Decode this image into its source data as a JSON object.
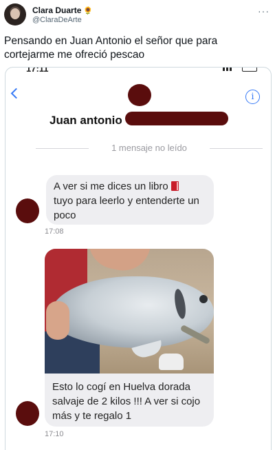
{
  "tweet": {
    "author_name": "Clara Duarte",
    "author_handle": "@ClaraDeArte",
    "text": "Pensando en Juan Antonio el señor que para cortejarme me ofreció pescao",
    "more_label": "···",
    "name_emoji": "🌻"
  },
  "screenshot": {
    "status_time": "17:11",
    "contact_name": "Juan antonio",
    "info_label": "i",
    "unread_label": "1 mensaje no leído",
    "messages": [
      {
        "text": "A ver si me dices un libro",
        "text_after_emoji": "tuyo para leerlo y entenderte un poco",
        "emoji": "book-icon",
        "time": "17:08"
      },
      {
        "caption": "Esto lo cogí en Huelva dorada salvaje de 2 kilos !!! A ver si cojo más y te regalo 1",
        "time": "17:10"
      }
    ]
  },
  "colors": {
    "ios_blue": "#3478f6",
    "bubble_gray": "#eeeef1",
    "redaction": "#5a0d0d"
  }
}
